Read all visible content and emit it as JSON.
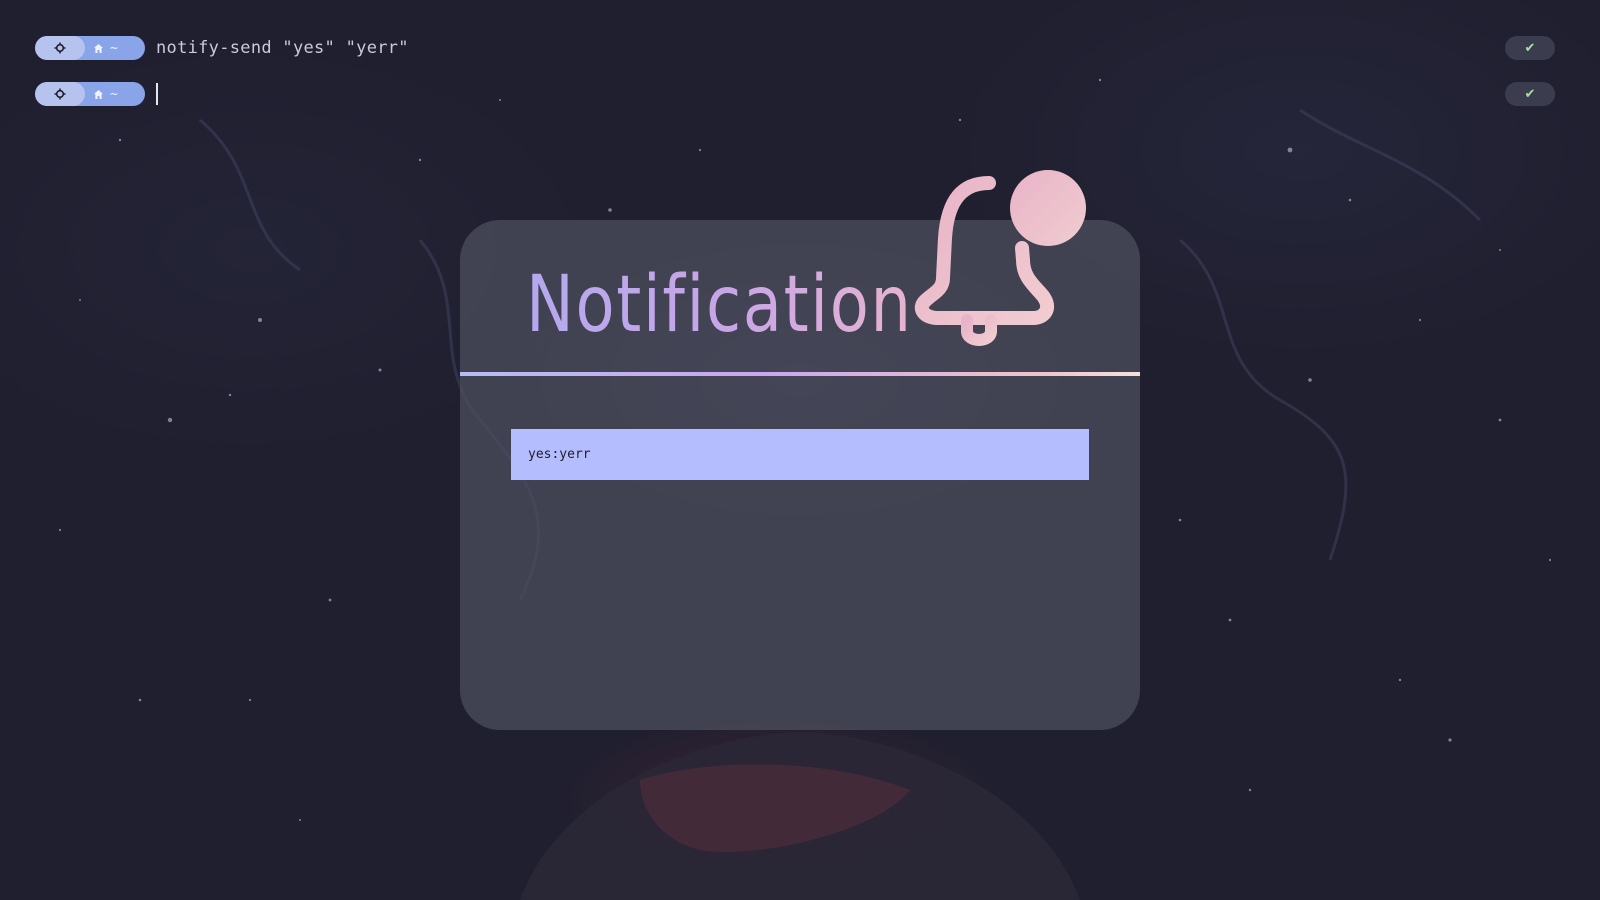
{
  "terminal": {
    "lines": [
      {
        "command": "notify-send \"yes\" \"yerr\"",
        "status": "✔",
        "path": "~",
        "os_icon": "gear-icon",
        "home_icon": "home-icon"
      },
      {
        "command": "",
        "status": "✔",
        "path": "~",
        "os_icon": "gear-icon",
        "home_icon": "home-icon"
      }
    ]
  },
  "notification": {
    "title": "Notification",
    "body": "yes:yerr",
    "icon": "bell-icon"
  },
  "colors": {
    "background": "#1e1e2e",
    "pill_blue": "#89a4e8",
    "pill_light": "#b6c3ef",
    "status_ok": "#a6e3a1",
    "card": "#4e4f5e",
    "body_box": "#b4befe",
    "title_gradient_start": "#b4a8ee",
    "title_gradient_end": "#e7b4cf",
    "bell": "#ebb9c4"
  }
}
